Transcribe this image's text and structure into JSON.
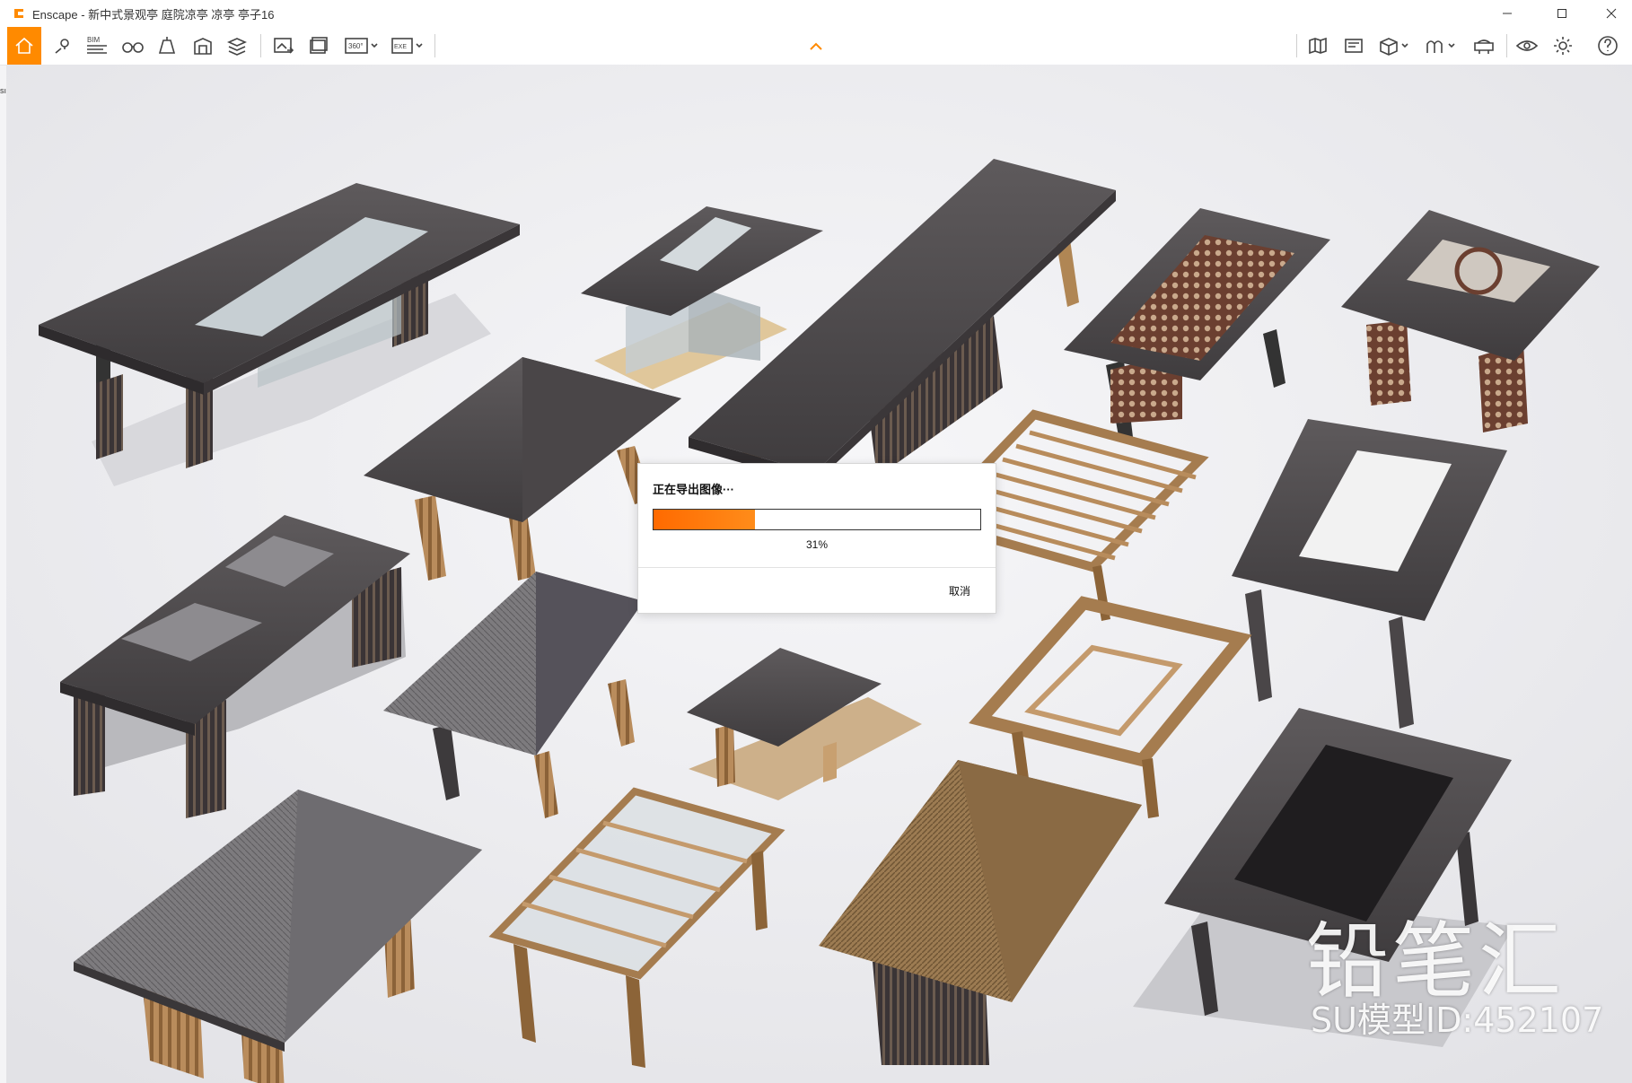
{
  "window": {
    "app_title": "Enscape - 新中式景观亭 庭院凉亭 凉亭 亭子16",
    "controls": [
      "minimize",
      "maximize",
      "close"
    ]
  },
  "toolbar": {
    "left_tools": [
      {
        "name": "home",
        "icon": "home-icon",
        "active": true
      },
      {
        "name": "views",
        "icon": "map-pin-icon"
      },
      {
        "name": "bim",
        "icon": "bim-icon",
        "label": "BIM"
      },
      {
        "name": "walk",
        "icon": "binoculars-icon"
      },
      {
        "name": "assets",
        "icon": "bell-asset-icon"
      },
      {
        "name": "asset-library",
        "icon": "building-icon"
      },
      {
        "name": "material",
        "icon": "layers-icon"
      },
      {
        "name": "video",
        "icon": "clapper-icon"
      },
      {
        "name": "render-image",
        "icon": "screenshot-icon"
      },
      {
        "name": "batch-render",
        "icon": "batch-icon"
      },
      {
        "name": "panorama",
        "icon": "panorama-icon",
        "label": "360°"
      },
      {
        "name": "export-exe",
        "icon": "exe-export-icon",
        "label": "EXE"
      }
    ],
    "center_toggle": "chevron-up-icon",
    "right_tools": [
      {
        "name": "map",
        "icon": "map-icon"
      },
      {
        "name": "mini-map",
        "icon": "minimap-icon"
      },
      {
        "name": "cube",
        "icon": "cube-icon"
      },
      {
        "name": "people",
        "icon": "atmosphere-icon"
      },
      {
        "name": "safe-frame",
        "icon": "vr-icon"
      },
      {
        "name": "visual-settings",
        "icon": "eye-icon"
      },
      {
        "name": "settings",
        "icon": "gear-icon"
      },
      {
        "name": "help",
        "icon": "help-icon"
      }
    ],
    "accent": "#ff8a00"
  },
  "dialog": {
    "title": "正在导出图像···",
    "progress_fraction": 0.31,
    "progress_text": "31%",
    "cancel_label": "取消",
    "progress_color": "#ff6a00"
  },
  "watermark": {
    "brand": "铅笔汇",
    "model_id": "SU模型ID:452107"
  }
}
